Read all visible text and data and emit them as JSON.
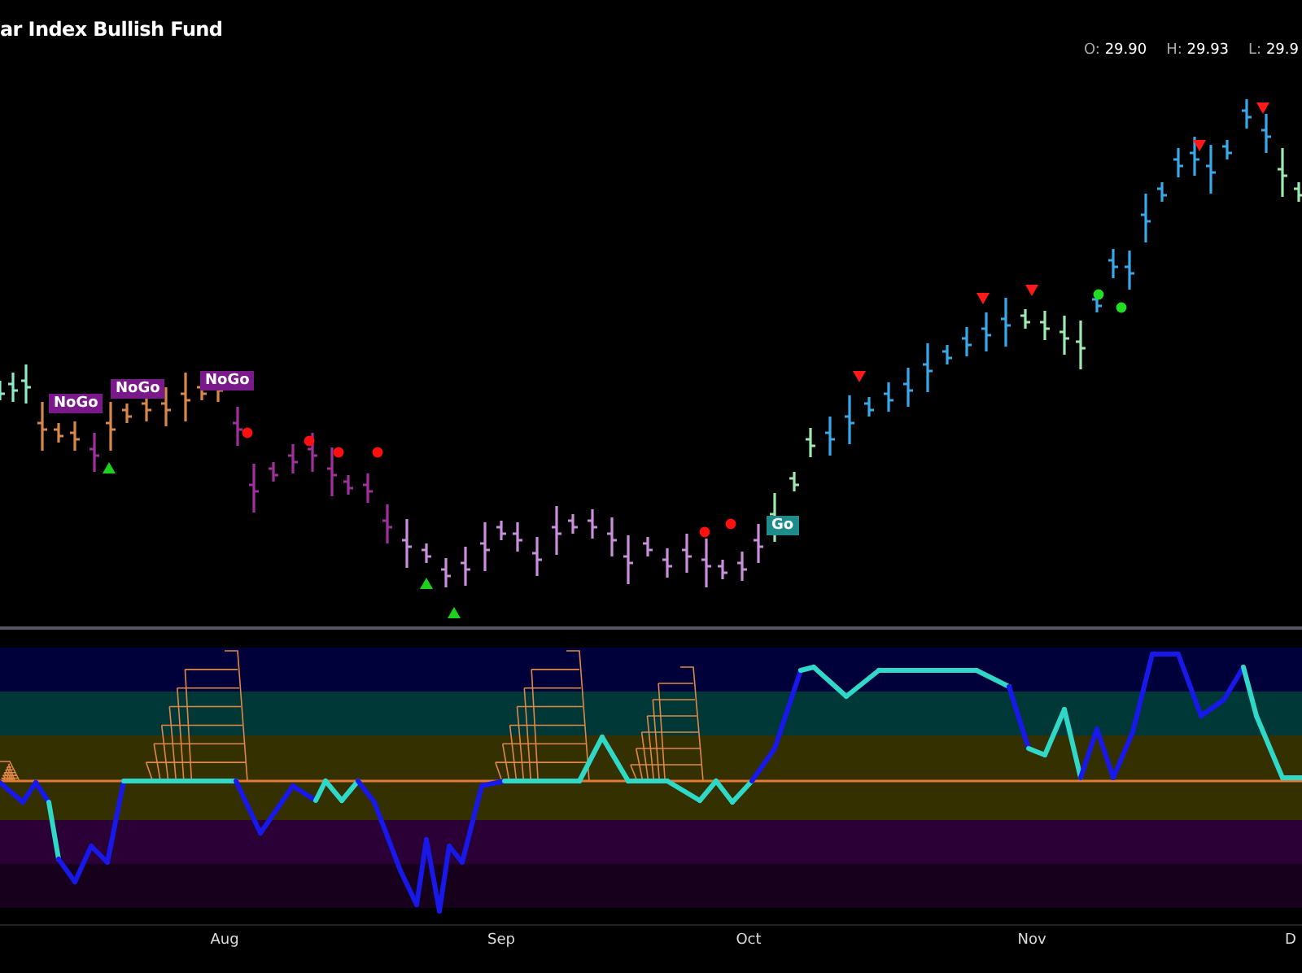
{
  "title": "ar Index Bullish Fund",
  "ohlc": [
    {
      "label": "O:",
      "value": "29.90"
    },
    {
      "label": "H:",
      "value": "29.93"
    },
    {
      "label": "L:",
      "value": "29.9"
    }
  ],
  "signal_labels": [
    {
      "text": "NoGo",
      "kind": "nogo"
    },
    {
      "text": "NoGo",
      "kind": "nogo"
    },
    {
      "text": "NoGo",
      "kind": "nogo"
    },
    {
      "text": "Go",
      "kind": "go"
    }
  ],
  "x_axis": [
    "Aug",
    "Sep",
    "Oct",
    "Nov",
    "D"
  ]
}
